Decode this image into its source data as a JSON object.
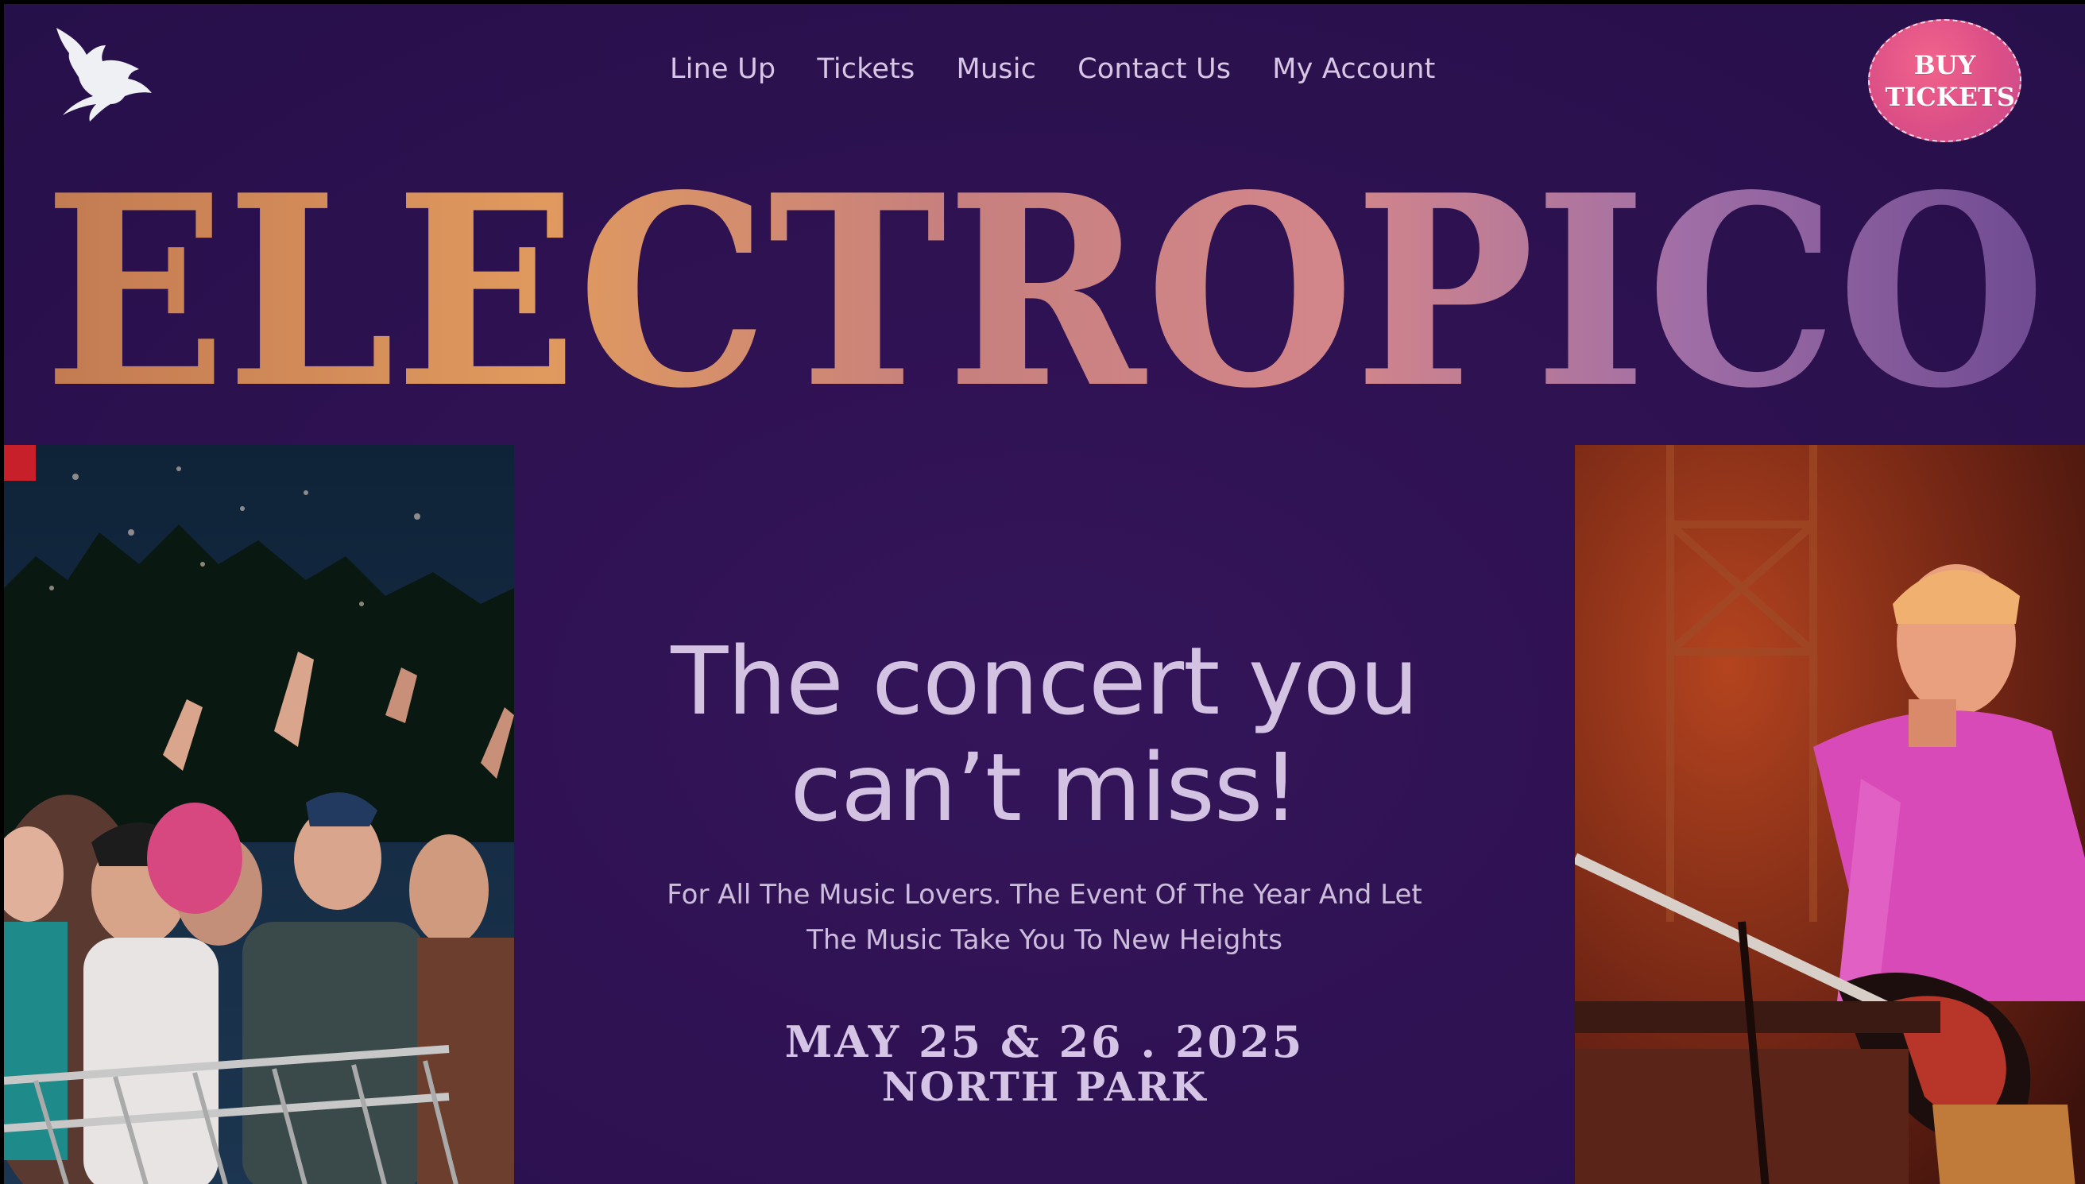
{
  "nav": {
    "items": [
      {
        "label": "Line Up"
      },
      {
        "label": "Tickets"
      },
      {
        "label": "Music"
      },
      {
        "label": "Contact Us"
      },
      {
        "label": "My Account"
      }
    ],
    "buy_button": {
      "line1": "BUY",
      "line2": "TICKETS"
    }
  },
  "brand": {
    "wordmark": "ELECTROPICO",
    "logo_icon": "dragon-icon"
  },
  "hero": {
    "headline_line1": "The concert you",
    "headline_line2": "can’t miss!",
    "subtext": "For All The Music Lovers. The Event Of The Year And Let The Music Take You To New Heights",
    "date": "MAY 25 & 26 . 2025",
    "venue": "NORTH PARK"
  },
  "colors": {
    "background": "#2d1150",
    "nav_text": "#d7c7e4",
    "accent_pink": "#e0508a",
    "wordmark_orange": "#d88a58",
    "wordmark_purple": "#8a5aa8"
  }
}
